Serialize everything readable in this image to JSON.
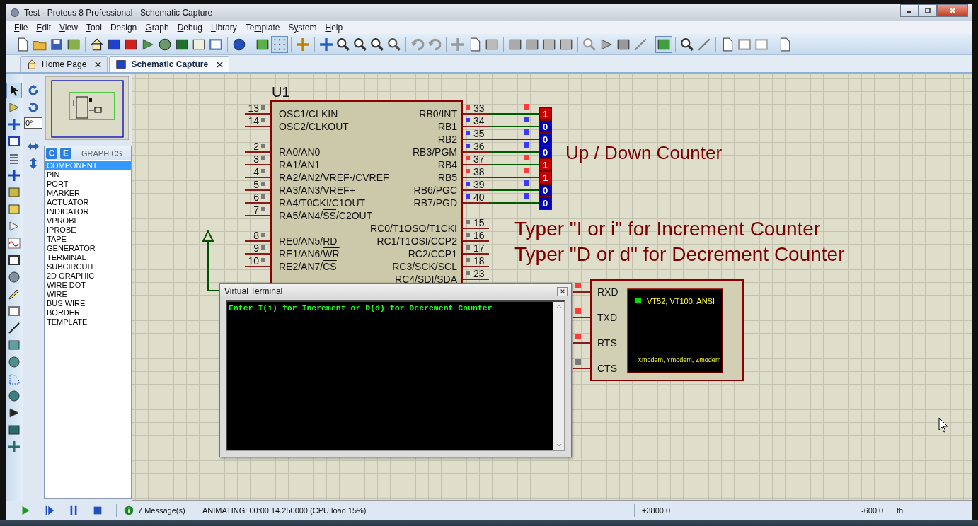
{
  "window": {
    "title": "Test - Proteus 8 Professional - Schematic Capture"
  },
  "menu": [
    {
      "accel": "F",
      "rest": "ile"
    },
    {
      "accel": "E",
      "rest": "dit"
    },
    {
      "accel": "V",
      "rest": "iew"
    },
    {
      "accel": "T",
      "rest": "ool"
    },
    {
      "lead": "Desi",
      "accel": "g",
      "rest": "n"
    },
    {
      "accel": "G",
      "rest": "raph"
    },
    {
      "accel": "D",
      "rest": "ebug"
    },
    {
      "accel": "L",
      "rest": "ibrary"
    },
    {
      "lead": "Te",
      "accel": "m",
      "rest": "plate"
    },
    {
      "lead": "S",
      "accel": "y",
      "rest": "stem"
    },
    {
      "accel": "H",
      "rest": "elp"
    }
  ],
  "toolbar_toggles": {
    "grid": true,
    "design_explorer": true
  },
  "tabs": [
    {
      "label": "Home Page",
      "selected": false
    },
    {
      "label": "Schematic Capture",
      "selected": true
    }
  ],
  "orientation": {
    "angle": "0°"
  },
  "object_selector": {
    "buttons": [
      "C",
      "E"
    ],
    "title": "GRAPHICS",
    "items": [
      {
        "label": "COMPONENT",
        "selected": true
      },
      {
        "label": "PIN",
        "selected": false
      },
      {
        "label": "PORT",
        "selected": false
      },
      {
        "label": "MARKER",
        "selected": false
      },
      {
        "label": "ACTUATOR",
        "selected": false
      },
      {
        "label": "INDICATOR",
        "selected": false
      },
      {
        "label": "VPROBE",
        "selected": false
      },
      {
        "label": "IPROBE",
        "selected": false
      },
      {
        "label": "TAPE",
        "selected": false
      },
      {
        "label": "GENERATOR",
        "selected": false
      },
      {
        "label": "TERMINAL",
        "selected": false
      },
      {
        "label": "SUBCIRCUIT",
        "selected": false
      },
      {
        "label": "2D GRAPHIC",
        "selected": false
      },
      {
        "label": "WIRE DOT",
        "selected": false
      },
      {
        "label": "WIRE",
        "selected": false
      },
      {
        "label": "BUS WIRE",
        "selected": false
      },
      {
        "label": "BORDER",
        "selected": false
      },
      {
        "label": "TEMPLATE",
        "selected": false
      }
    ]
  },
  "schematic": {
    "reference": "U1",
    "left_pin_groups": [
      [
        {
          "number": "13",
          "label": "OSC1/CLKIN"
        },
        {
          "number": "14",
          "label": "OSC2/CLKOUT"
        }
      ],
      [
        {
          "number": "2",
          "label": "RA0/AN0"
        },
        {
          "number": "3",
          "label": "RA1/AN1"
        },
        {
          "number": "4",
          "label": "RA2/AN2/VREF-/CVREF"
        },
        {
          "number": "5",
          "label": "RA3/AN3/VREF+"
        },
        {
          "number": "6",
          "label": "RA4/T0CKI/C1OUT"
        },
        {
          "number": "7",
          "label_parts": [
            {
              "text": "RA5/AN4/",
              "overline": false
            },
            {
              "text": "SS",
              "overline": true
            },
            {
              "text": "/C2OUT",
              "overline": false
            }
          ]
        }
      ],
      [
        {
          "number": "8",
          "label_parts": [
            {
              "text": "RE0/AN5/",
              "overline": false
            },
            {
              "text": "RD",
              "overline": true
            }
          ]
        },
        {
          "number": "9",
          "label_parts": [
            {
              "text": "RE1/AN6/",
              "overline": false
            },
            {
              "text": "WR",
              "overline": true
            }
          ]
        },
        {
          "number": "10",
          "label_parts": [
            {
              "text": "RE2/AN7/",
              "overline": false
            },
            {
              "text": "CS",
              "overline": true
            }
          ]
        }
      ]
    ],
    "right_pin_groups": [
      [
        {
          "number": "33",
          "label": "RB0/INT",
          "color": "#ff3a3a",
          "probe": {
            "value": "1",
            "color": "#c40000"
          }
        },
        {
          "number": "34",
          "label": "RB1",
          "color": "#3a3aff",
          "probe": {
            "value": "0",
            "color": "#0000b4"
          }
        },
        {
          "number": "35",
          "label": "RB2",
          "color": "#3a3aff",
          "probe": {
            "value": "0",
            "color": "#0000b4"
          }
        },
        {
          "number": "36",
          "label": "RB3/PGM",
          "color": "#3a3aff",
          "probe": {
            "value": "0",
            "color": "#0000b4"
          }
        },
        {
          "number": "37",
          "label": "RB4",
          "color": "#ff3a3a",
          "probe": {
            "value": "1",
            "color": "#c40000"
          }
        },
        {
          "number": "38",
          "label": "RB5",
          "color": "#ff3a3a",
          "probe": {
            "value": "1",
            "color": "#c40000"
          }
        },
        {
          "number": "39",
          "label": "RB6/PGC",
          "color": "#3a3aff",
          "probe": {
            "value": "0",
            "color": "#0000b4"
          }
        },
        {
          "number": "40",
          "label": "RB7/PGD",
          "color": "#3a3aff",
          "probe": {
            "value": "0",
            "color": "#0000b4"
          }
        }
      ],
      [
        {
          "number": "15",
          "label": "RC0/T1OSO/T1CKI",
          "color": "#7a7a7a"
        },
        {
          "number": "16",
          "label": "RC1/T1OSI/CCP2",
          "color": "#7a7a7a"
        },
        {
          "number": "17",
          "label": "RC2/CCP1",
          "color": "#7a7a7a"
        },
        {
          "number": "18",
          "label": "RC3/SCK/SCL",
          "color": "#7a7a7a"
        },
        {
          "number": "23",
          "label": "RC4/SDI/SDA",
          "color": "#7a7a7a"
        }
      ]
    ],
    "annotations": [
      "Up / Down Counter",
      "Typer \"I or i\" for Increment Counter",
      "Typer \"D or d\" for Decrement Counter"
    ],
    "terminal_component": {
      "pins": [
        {
          "label": "RXD",
          "color": "#ff3a3a"
        },
        {
          "label": "TXD",
          "color": "#ff3a3a"
        },
        {
          "label": "RTS",
          "color": "#ff3a3a"
        },
        {
          "label": "CTS",
          "color": "#7a7a7a"
        }
      ],
      "modes": "VT52, VT100, ANSI",
      "protocols": "Xmodem, Ymodem, Zmodem"
    }
  },
  "virtual_terminal": {
    "title": "Virtual Terminal",
    "lines": [
      "Enter I(i) for Increment or D(d) for Decrement Counter"
    ]
  },
  "status_bar": {
    "messages": "7 Message(s)",
    "status": "ANIMATING: 00:00:14.250000 (CPU load 15%)",
    "x_coord": "+3800.0",
    "y_coord": "-600.0",
    "column_5": "th"
  }
}
